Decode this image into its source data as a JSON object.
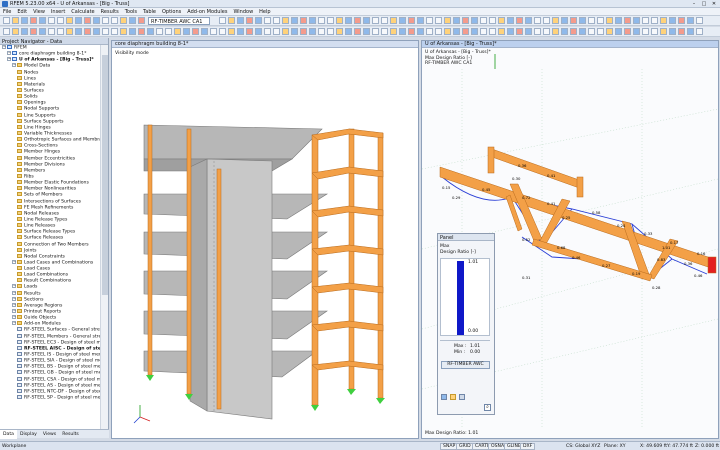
{
  "window": {
    "title": "RFEM 5.23.00 x64 - U of Arkansas - [Big - Truss]"
  },
  "menu": [
    "File",
    "Edit",
    "View",
    "Insert",
    "Calculate",
    "Results",
    "Tools",
    "Table",
    "Options",
    "Add-on Modules",
    "Window",
    "Help"
  ],
  "toolbar": {
    "module_combo": "RF-TIMBER AWC CA1"
  },
  "navigator": {
    "header": "Project Navigator - Data",
    "items": [
      {
        "label": "RFEM",
        "icon": "rfem-icon",
        "level": 0
      },
      {
        "label": "core diaphragm building 8-1*",
        "icon": "model-icon",
        "level": 1
      },
      {
        "label": "U of Arkansas - [Big - Truss]*",
        "icon": "model-icon",
        "level": 1,
        "bold": true
      },
      {
        "label": "Model Data",
        "icon": "folder-icon",
        "level": 2
      },
      {
        "label": "Nodes",
        "icon": "folder-icon",
        "level": 3
      },
      {
        "label": "Lines",
        "icon": "folder-icon",
        "level": 3
      },
      {
        "label": "Materials",
        "icon": "folder-icon",
        "level": 3
      },
      {
        "label": "Surfaces",
        "icon": "folder-icon",
        "level": 3
      },
      {
        "label": "Solids",
        "icon": "folder-icon",
        "level": 3
      },
      {
        "label": "Openings",
        "icon": "folder-icon",
        "level": 3
      },
      {
        "label": "Nodal Supports",
        "icon": "folder-icon",
        "level": 3
      },
      {
        "label": "Line Supports",
        "icon": "folder-icon",
        "level": 3
      },
      {
        "label": "Surface Supports",
        "icon": "folder-icon",
        "level": 3
      },
      {
        "label": "Line Hinges",
        "icon": "folder-icon",
        "level": 3
      },
      {
        "label": "Variable Thicknesses",
        "icon": "folder-icon",
        "level": 3
      },
      {
        "label": "Orthotropic Surfaces and Membra",
        "icon": "folder-icon",
        "level": 3
      },
      {
        "label": "Cross-Sections",
        "icon": "folder-icon",
        "level": 3
      },
      {
        "label": "Member Hinges",
        "icon": "folder-icon",
        "level": 3
      },
      {
        "label": "Member Eccentricities",
        "icon": "folder-icon",
        "level": 3
      },
      {
        "label": "Member Divisions",
        "icon": "folder-icon",
        "level": 3
      },
      {
        "label": "Members",
        "icon": "folder-icon",
        "level": 3
      },
      {
        "label": "Ribs",
        "icon": "folder-icon",
        "level": 3
      },
      {
        "label": "Member Elastic Foundations",
        "icon": "folder-icon",
        "level": 3
      },
      {
        "label": "Member Nonlinearities",
        "icon": "folder-icon",
        "level": 3
      },
      {
        "label": "Sets of Members",
        "icon": "folder-icon",
        "level": 3
      },
      {
        "label": "Intersections of Surfaces",
        "icon": "folder-icon",
        "level": 3
      },
      {
        "label": "FE Mesh Refinements",
        "icon": "folder-icon",
        "level": 3
      },
      {
        "label": "Nodal Releases",
        "icon": "folder-icon",
        "level": 3
      },
      {
        "label": "Line Release Types",
        "icon": "folder-icon",
        "level": 3
      },
      {
        "label": "Line Releases",
        "icon": "folder-icon",
        "level": 3
      },
      {
        "label": "Surface Release Types",
        "icon": "folder-icon",
        "level": 3
      },
      {
        "label": "Surface Releases",
        "icon": "folder-icon",
        "level": 3
      },
      {
        "label": "Connection of Two Members",
        "icon": "folder-icon",
        "level": 3
      },
      {
        "label": "Joints",
        "icon": "folder-icon",
        "level": 3
      },
      {
        "label": "Nodal Constraints",
        "icon": "folder-icon",
        "level": 3
      },
      {
        "label": "Load Cases and Combinations",
        "icon": "folder-icon",
        "level": 2
      },
      {
        "label": "Load Cases",
        "icon": "folder-icon",
        "level": 3
      },
      {
        "label": "Load Combinations",
        "icon": "folder-icon",
        "level": 3
      },
      {
        "label": "Result Combinations",
        "icon": "folder-icon",
        "level": 3
      },
      {
        "label": "Loads",
        "icon": "folder-icon",
        "level": 2
      },
      {
        "label": "Results",
        "icon": "folder-icon",
        "level": 2
      },
      {
        "label": "Sections",
        "icon": "folder-icon",
        "level": 2
      },
      {
        "label": "Average Regions",
        "icon": "folder-icon",
        "level": 2
      },
      {
        "label": "Printout Reports",
        "icon": "folder-icon",
        "level": 2
      },
      {
        "label": "Guide Objects",
        "icon": "folder-icon",
        "level": 2
      },
      {
        "label": "Add-on Modules",
        "icon": "folder-icon",
        "level": 2
      },
      {
        "label": "RF-STEEL Surfaces - General stress",
        "icon": "module-icon",
        "level": 3
      },
      {
        "label": "RF-STEEL Members - General stres",
        "icon": "module-icon",
        "level": 3
      },
      {
        "label": "RF-STEEL EC3 - Design of steel me",
        "icon": "module-icon",
        "level": 3
      },
      {
        "label": "RF-STEEL AISC - Design of steel r",
        "icon": "module-icon",
        "level": 3,
        "bold": true
      },
      {
        "label": "RF-STEEL IS - Design of steel mem",
        "icon": "module-icon",
        "level": 3
      },
      {
        "label": "RF-STEEL SIA - Design of steel me",
        "icon": "module-icon",
        "level": 3
      },
      {
        "label": "RF-STEEL BS - Design of steel men",
        "icon": "module-icon",
        "level": 3
      },
      {
        "label": "RF-STEEL GB - Design of steel mer",
        "icon": "module-icon",
        "level": 3
      },
      {
        "label": "RF-STEEL CSA - Design of steel me",
        "icon": "module-icon",
        "level": 3
      },
      {
        "label": "RF-STEEL AS - Design of steel mer",
        "icon": "module-icon",
        "level": 3
      },
      {
        "label": "RF-STEEL NTC-DF - Design of stee",
        "icon": "module-icon",
        "level": 3
      },
      {
        "label": "RF-STEEL SP - Design of steel mer",
        "icon": "module-icon",
        "level": 3
      }
    ],
    "tabs": [
      "Data",
      "Display",
      "Views",
      "Results"
    ]
  },
  "view_left": {
    "tab": "core diaphragm building 8-1*",
    "caption": "Visibility mode"
  },
  "view_right": {
    "tab": "U of Arkansas - [Big - Truss]*",
    "caption_lines": [
      "U of Arkansas - [Big - Truss]*",
      "Max Design Ratio [-]",
      "RF-TIMBER AWC CA1"
    ],
    "footer": "Max Design Ratio: 1.01"
  },
  "ratios": [
    "0.45",
    "0.30",
    "0.72",
    "0.41",
    "0.25",
    "0.58",
    "0.24",
    "0.33",
    "0.17",
    "0.16",
    "0.36",
    "0.41",
    "0.52",
    "0.68",
    "0.46",
    "0.27",
    "0.19",
    "0.83",
    "1.01",
    "0.36",
    "0.46",
    "0.15",
    "0.29",
    "0.31",
    "0.28"
  ],
  "panel": {
    "title": "Panel",
    "line1": "Max",
    "line2": "Design Ratio [-]",
    "top": "1.01",
    "bottom": "0.00",
    "max_label": "Max :",
    "max_value": "1.01",
    "min_label": "Min :",
    "min_value": "0.00",
    "button": "RF-TIMBER AWC",
    "fill_fraction": 1.0
  },
  "status": {
    "workplane": "Workplane",
    "toggles": [
      "SNAP",
      "GRID",
      "CARTES",
      "OSNAP",
      "GLINES",
      "DXF"
    ],
    "cs": "CS: Global XYZ",
    "plane": "Plane: XY",
    "x": "X: 49.609 ft",
    "y": "Y: 47.774 ft",
    "z": "Z: 0.000 ft"
  },
  "colors": {
    "timber": "#f3a047",
    "slab": "#a8a8a8",
    "support": "#3fcf3f",
    "accent": "#0f18c8"
  }
}
